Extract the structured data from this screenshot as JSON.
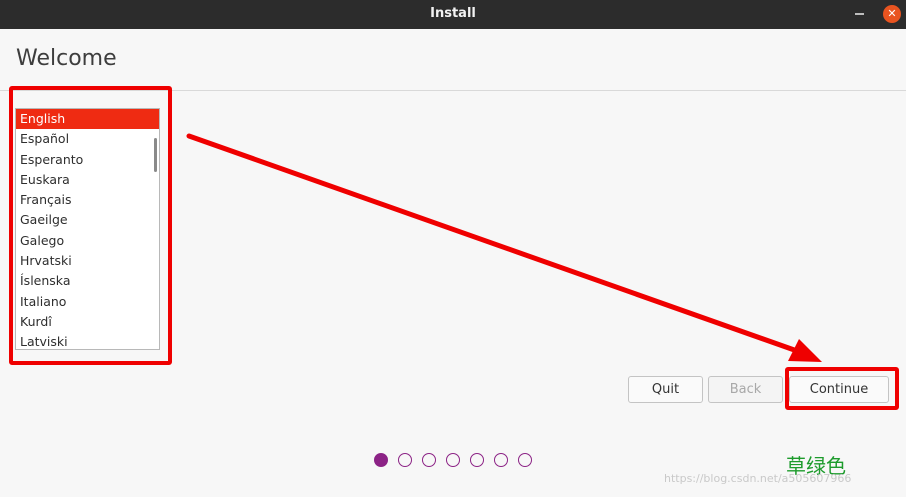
{
  "window": {
    "title": "Install",
    "minimize_icon": "minimize-icon",
    "close_icon": "close-icon",
    "close_glyph": "✕"
  },
  "page": {
    "title": "Welcome"
  },
  "languages": [
    "English",
    "Español",
    "Esperanto",
    "Euskara",
    "Français",
    "Gaeilge",
    "Galego",
    "Hrvatski",
    "Íslenska",
    "Italiano",
    "Kurdî",
    "Latviski"
  ],
  "selected_language": "English",
  "buttons": {
    "quit": "Quit",
    "back": "Back",
    "continue": "Continue"
  },
  "progress": {
    "total_steps": 7,
    "current_step": 1
  },
  "annotations": {
    "highlight_color": "#ef0000"
  },
  "watermark": {
    "text_cn": "草绿色",
    "url": "https://blog.csdn.net/a505607966"
  },
  "colors": {
    "accent": "#8c2386",
    "selection": "#ef2b12",
    "titlebar": "#2c2c2c",
    "close_button": "#e95420"
  }
}
